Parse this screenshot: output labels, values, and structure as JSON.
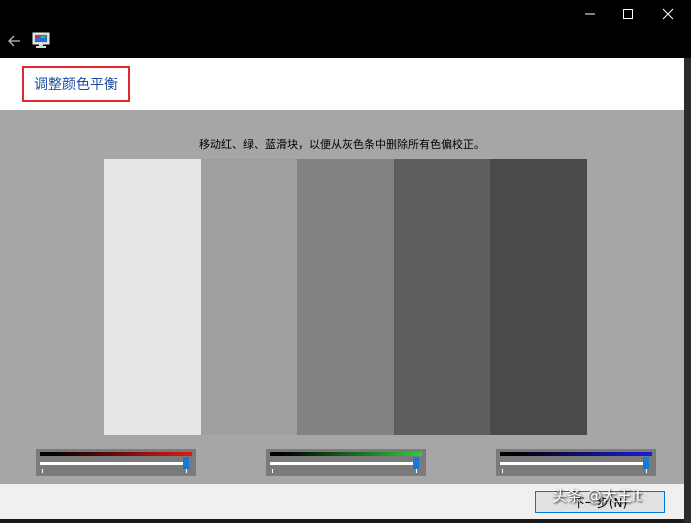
{
  "window": {
    "title_bar": {
      "back_icon": "arrow-left-icon",
      "app_icon": "display-monitor-icon",
      "controls": [
        "minimize-icon",
        "maximize-icon",
        "close-icon"
      ]
    }
  },
  "header": {
    "title": "调整颜色平衡",
    "title_color": "#1e4b9e",
    "highlight_color": "#e0272f"
  },
  "content": {
    "instruction": "移动红、绿、蓝滑块，以便从灰色条中删除所有色偏校正。",
    "gray_bars": [
      "#e6e6e6",
      "#9f9f9f",
      "#828282",
      "#5e5e5e",
      "#4a4a4a"
    ]
  },
  "sliders": [
    {
      "name": "red",
      "gradient_end": "#e01919",
      "level": 1.0
    },
    {
      "name": "green",
      "gradient_end": "#2ecc40",
      "level": 1.0
    },
    {
      "name": "blue",
      "gradient_end": "#1c1cd9",
      "level": 1.0
    }
  ],
  "footer": {
    "next_button_label": "下一步(N)"
  },
  "watermark": "头条 @大王it"
}
